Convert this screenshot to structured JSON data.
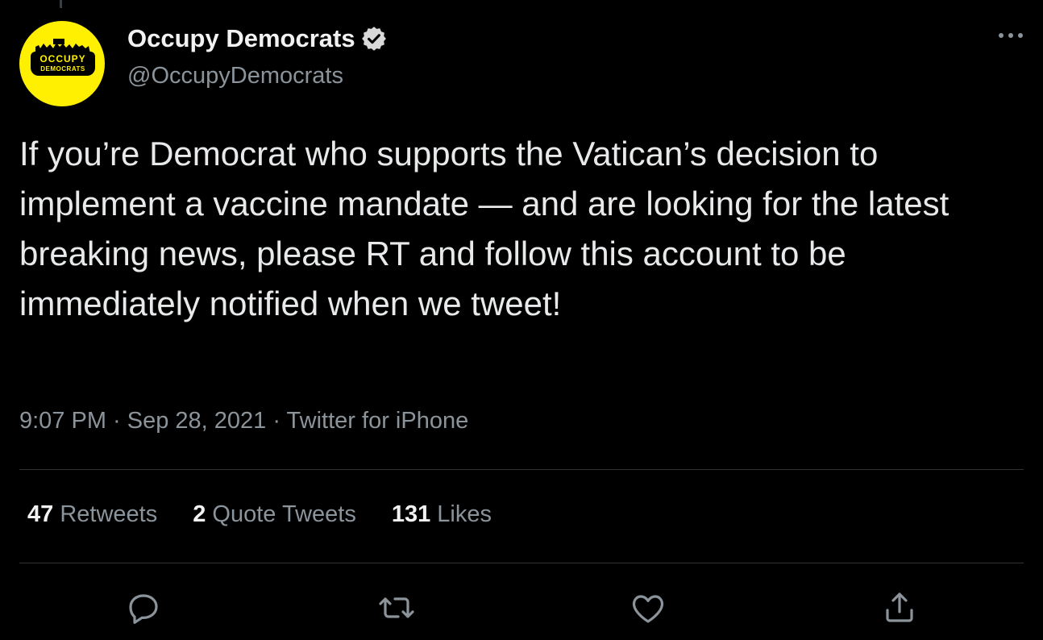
{
  "account": {
    "display_name": "Occupy Democrats",
    "handle": "@OccupyDemocrats",
    "avatar_text_top": "OCCUPY",
    "avatar_text_bottom": "DEMOCRATS",
    "verified": true
  },
  "tweet": {
    "text": "If you’re Democrat who supports the Vatican’s decision to implement a vaccine mandate — and are looking for the latest breaking news, please RT and follow this account to be immediately notified when we tweet!",
    "meta": "9:07 PM · Sep 28, 2021 · Twitter for iPhone"
  },
  "stats": {
    "retweets_count": "47",
    "retweets_label": "Retweets",
    "quotes_count": "2",
    "quotes_label": "Quote Tweets",
    "likes_count": "131",
    "likes_label": "Likes"
  },
  "icons": {
    "verified": "verified-badge-icon",
    "more": "more-options-icon",
    "reply": "reply-icon",
    "retweet": "retweet-icon",
    "like": "like-icon",
    "share": "share-icon"
  },
  "colors": {
    "background": "#000000",
    "avatar_yellow": "#ffef00",
    "secondary_text": "#8b939b",
    "divider": "#2f3336"
  }
}
